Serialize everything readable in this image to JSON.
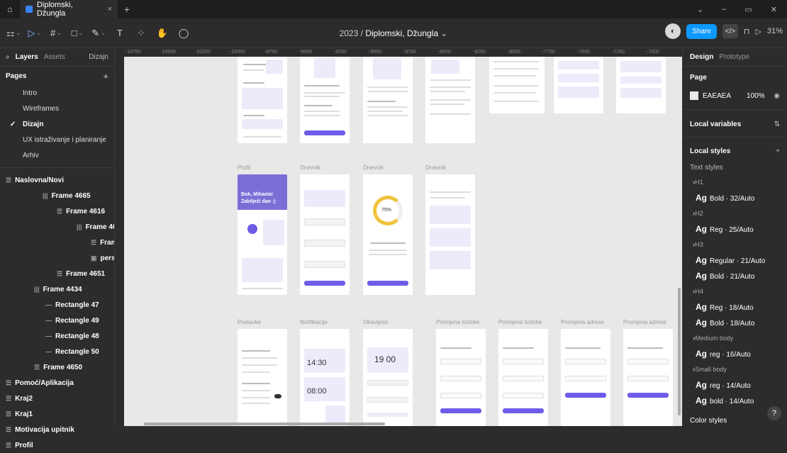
{
  "tabs": {
    "home_icon": "home-icon",
    "active": "Diplomski, Džungla",
    "close": "×",
    "add": "+"
  },
  "window": {
    "minimize": "–",
    "restore": "▭",
    "close": "✕"
  },
  "toolbar": {
    "title_year": "2023",
    "title_sep": "/",
    "title_file": "Diplomski, Džungla",
    "title_caret": "⌄",
    "share": "Share",
    "zoom": "31%",
    "dev_mode": "</>",
    "play": "▷"
  },
  "left_panel": {
    "tab_layers": "Layers",
    "tab_assets": "Assets",
    "page_dropdown": "Dizajn",
    "pages_title": "Pages",
    "pages": [
      "Intro",
      "Wireframes",
      "Dizajn",
      "UX istraživanje i planiranje",
      "Arhiv"
    ],
    "current_page": "Dizajn",
    "layers": [
      {
        "label": "Naslovna/Novi",
        "icon": "☰",
        "bold": true
      },
      {
        "label": "Frame 4665",
        "icon": "|||",
        "bold": true
      },
      {
        "label": "Frame 4616",
        "icon": "☰",
        "bold": true
      },
      {
        "label": "Frame 4664",
        "icon": "|||",
        "bold": true
      },
      {
        "label": "Frame ...",
        "icon": "☰",
        "bold": true
      },
      {
        "label": "person...",
        "icon": "▣",
        "bold": true
      },
      {
        "label": "Frame 4651",
        "icon": "☰",
        "bold": true
      },
      {
        "label": "Frame 4434",
        "icon": "|||",
        "bold": true
      },
      {
        "label": "Rectangle 47",
        "icon": "—",
        "bold": true
      },
      {
        "label": "Rectangle 49",
        "icon": "—",
        "bold": true
      },
      {
        "label": "Rectangle 48",
        "icon": "—",
        "bold": true
      },
      {
        "label": "Rectangle 50",
        "icon": "—",
        "bold": true
      },
      {
        "label": "Frame 4650",
        "icon": "☰",
        "bold": true
      },
      {
        "label": "Pomoć/Aplikacija",
        "icon": "☰",
        "bold": true
      },
      {
        "label": "Kraj2",
        "icon": "☰",
        "bold": true
      },
      {
        "label": "Kraj1",
        "icon": "☰",
        "bold": true
      },
      {
        "label": "Motivacija upitnik",
        "icon": "☰",
        "bold": true
      },
      {
        "label": "Profil",
        "icon": "☰",
        "bold": true
      }
    ]
  },
  "right_panel": {
    "tab_design": "Design",
    "tab_prototype": "Prototype",
    "page_section": "Page",
    "page_color": "EAEAEA",
    "page_opacity": "100%",
    "local_variables": "Local variables",
    "local_styles": "Local styles",
    "text_styles": "Text styles",
    "styles": [
      {
        "group": "H1",
        "items": [
          {
            "ag": "Ag",
            "name": "Bold · 32/Auto"
          }
        ]
      },
      {
        "group": "H2",
        "items": [
          {
            "ag": "Ag",
            "name": "Reg · 25/Auto"
          }
        ]
      },
      {
        "group": "H3",
        "items": [
          {
            "ag": "Ag",
            "name": "Regular · 21/Auto"
          },
          {
            "ag": "Ag",
            "name": "Bold · 21/Auto"
          }
        ]
      },
      {
        "group": "H4",
        "items": [
          {
            "ag": "Ag",
            "name": "Reg · 18/Auto"
          },
          {
            "ag": "Ag",
            "name": "Bold · 18/Auto"
          }
        ]
      },
      {
        "group": "Medium body",
        "items": [
          {
            "ag": "Ag",
            "name": "reg · 16/Auto"
          }
        ]
      },
      {
        "group": "Small body",
        "items": [
          {
            "ag": "Ag",
            "name": "reg · 14/Auto"
          },
          {
            "ag": "Ag",
            "name": "bold · 14/Auto"
          }
        ]
      }
    ],
    "color_styles": "Color styles",
    "help": "?"
  },
  "canvas": {
    "ruler_labels": [
      "-10750",
      "-10500",
      "-10250",
      "-10000",
      "-9750",
      "-9500",
      "-9250",
      "-9000",
      "-8750",
      "-8500",
      "-8250",
      "-8000",
      "-7750",
      "-7500",
      "-7250",
      "-7000"
    ],
    "row2_labels": [
      "Profil",
      "Dnevnik",
      "Dnevnik",
      "Dnevnik"
    ],
    "row3_labels": [
      "Postavke",
      "Notifikacije",
      "Obavijesti",
      "Promjena lozinke",
      "Promjena lozinke",
      "Promjena adrese",
      "Promjena adrese"
    ],
    "profil_greeting": "Bok, Mihaela!",
    "profil_sub": "Zabilježi dan :)",
    "dnevnik_percent": "75%",
    "time_a": "14:30",
    "time_b": "08:00",
    "time_c": "19 00"
  },
  "colors": {
    "accent": "#6c5ce7",
    "share": "#0d99ff",
    "canvas": "#e8e8e8",
    "panel": "#2c2c2c"
  }
}
